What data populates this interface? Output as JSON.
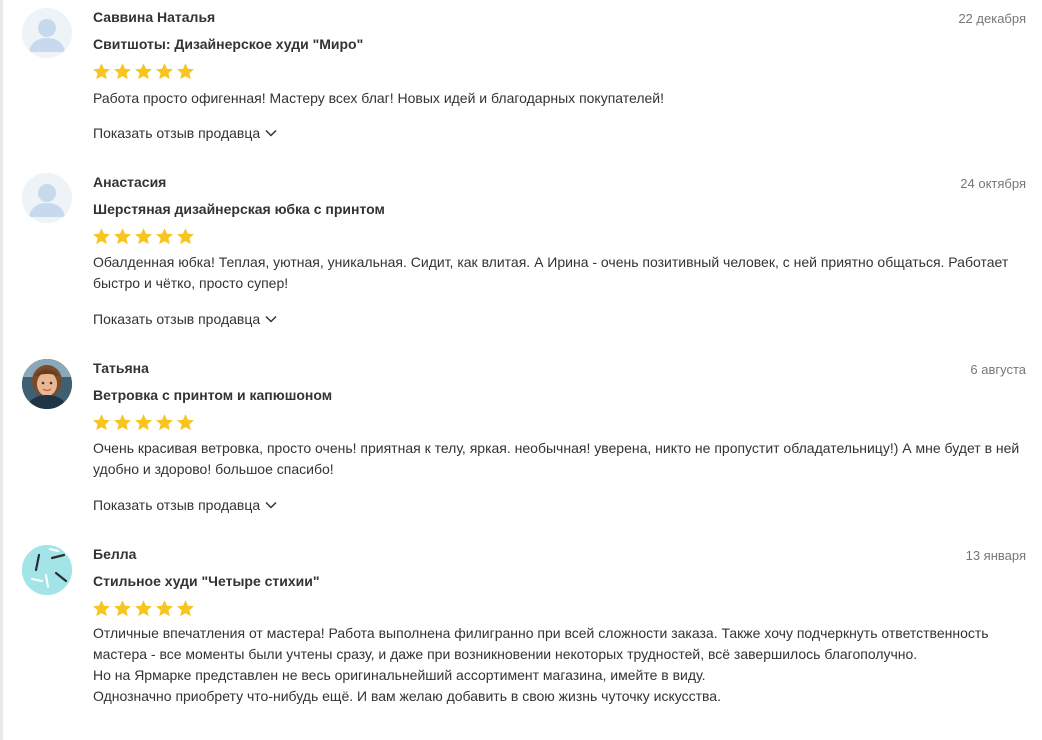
{
  "reviews": [
    {
      "author": "Саввина Наталья",
      "date": "22 декабря",
      "product": "Свитшоты: Дизайнерское худи \"Миро\"",
      "rating": 5,
      "avatar_icon": "default-user-avatar",
      "text": [
        "Работа просто офигенная! Мастеру всех благ! Новых идей и благодарных покупателей!"
      ],
      "show_seller_reply_label": "Показать отзыв продавца"
    },
    {
      "author": "Анастасия",
      "date": "24 октября",
      "product": "Шерстяная дизайнерская юбка с принтом",
      "rating": 5,
      "avatar_icon": "default-user-avatar",
      "text": [
        "Обалденная юбка! Теплая, уютная, уникальная. Сидит, как влитая. А Ирина - очень позитивный человек, с ней приятно общаться. Работает быстро и чётко, просто супер!"
      ],
      "show_seller_reply_label": "Показать отзыв продавца"
    },
    {
      "author": "Татьяна",
      "date": "6 августа",
      "product": "Ветровка с принтом и капюшоном",
      "rating": 5,
      "avatar_icon": "user-photo-avatar",
      "text": [
        "Очень красивая ветровка, просто очень! приятная к телу, яркая. необычная! уверена, никто не пропустит обладательницу!) А мне будет в ней удобно и здорово! большое спасибо!"
      ],
      "show_seller_reply_label": "Показать отзыв продавца"
    },
    {
      "author": "Белла",
      "date": "13 января",
      "product": "Стильное худи \"Четыре стихии\"",
      "rating": 5,
      "avatar_icon": "pattern-avatar",
      "text": [
        "Отличные впечатления от мастера! Работа выполнена филигранно при всей сложности заказа. Также хочу подчеркнуть ответственность мастера - все моменты были учтены сразу, и даже при возникновении некоторых трудностей, всё завершилось благополучно.",
        "Но на Ярмарке представлен не весь оригинальнейший ассортимент магазина, имейте в виду.",
        "Однозначно приобрету что-нибудь ещё. И вам желаю добавить в свою жизнь чуточку искусства."
      ]
    }
  ],
  "colors": {
    "star": "#f7c51e",
    "avatar_bg": "#eef3f8",
    "avatar_figure": "#c7d9ec",
    "text": "#333333",
    "date": "#777777"
  }
}
